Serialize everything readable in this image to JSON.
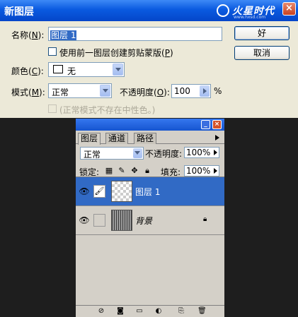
{
  "dialog": {
    "title": "新图层",
    "watermark": {
      "text": "火星时代",
      "subtext": "www.hxsd.com"
    },
    "close_glyph": "×",
    "name": {
      "label_pre": "名称(",
      "label_key": "N",
      "label_post": "):",
      "value": "图层 1"
    },
    "clip_checkbox": {
      "checked": false,
      "label_pre": "使用前一图层创建剪贴蒙版(",
      "label_key": "P",
      "label_post": ")"
    },
    "color": {
      "label_pre": "颜色(",
      "label_key": "C",
      "label_post": "):",
      "value": "无",
      "swatch": "#ffffff"
    },
    "mode": {
      "label_pre": "模式(",
      "label_key": "M",
      "label_post": "):",
      "value": "正常"
    },
    "opacity": {
      "label_pre": "不透明度(",
      "label_key": "O",
      "label_post": "):",
      "value": "100",
      "unit": "%"
    },
    "neutral_checkbox": {
      "checked": false,
      "disabled": true,
      "label": "(正常模式不存在中性色。)"
    },
    "ok_label": "好",
    "cancel_label": "取消"
  },
  "layers_panel": {
    "title_min_glyph": "_",
    "title_close_glyph": "×",
    "tabs": [
      "图层",
      "通道",
      "路径"
    ],
    "active_tab": 0,
    "blend_mode": "正常",
    "opacity_label": "不透明度:",
    "opacity_value": "100%",
    "lock_label": "锁定:",
    "fill_label": "填充:",
    "fill_value": "100%",
    "layers": [
      {
        "name": "图层 1",
        "selected": true,
        "visible": true,
        "thumb": "transparent",
        "link_icon": "brush"
      },
      {
        "name": "背景",
        "selected": false,
        "visible": true,
        "thumb": "stripes",
        "locked": true,
        "italic": true
      }
    ],
    "accent_color": "#316ac5"
  }
}
